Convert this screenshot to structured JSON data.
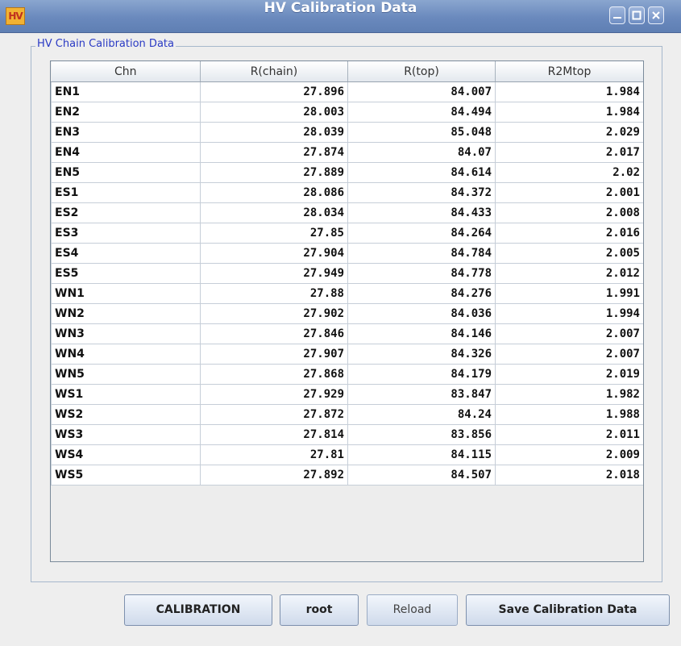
{
  "window": {
    "icon_text": "HV",
    "title": "HV Calibration Data"
  },
  "group": {
    "legend": "HV Chain Calibration Data"
  },
  "table": {
    "headers": [
      "Chn",
      "R(chain)",
      "R(top)",
      "R2Mtop"
    ],
    "rows": [
      [
        "EN1",
        "27.896",
        "84.007",
        "1.984"
      ],
      [
        "EN2",
        "28.003",
        "84.494",
        "1.984"
      ],
      [
        "EN3",
        "28.039",
        "85.048",
        "2.029"
      ],
      [
        "EN4",
        "27.874",
        "84.07",
        "2.017"
      ],
      [
        "EN5",
        "27.889",
        "84.614",
        "2.02"
      ],
      [
        "ES1",
        "28.086",
        "84.372",
        "2.001"
      ],
      [
        "ES2",
        "28.034",
        "84.433",
        "2.008"
      ],
      [
        "ES3",
        "27.85",
        "84.264",
        "2.016"
      ],
      [
        "ES4",
        "27.904",
        "84.784",
        "2.005"
      ],
      [
        "ES5",
        "27.949",
        "84.778",
        "2.012"
      ],
      [
        "WN1",
        "27.88",
        "84.276",
        "1.991"
      ],
      [
        "WN2",
        "27.902",
        "84.036",
        "1.994"
      ],
      [
        "WN3",
        "27.846",
        "84.146",
        "2.007"
      ],
      [
        "WN4",
        "27.907",
        "84.326",
        "2.007"
      ],
      [
        "WN5",
        "27.868",
        "84.179",
        "2.019"
      ],
      [
        "WS1",
        "27.929",
        "83.847",
        "1.982"
      ],
      [
        "WS2",
        "27.872",
        "84.24",
        "1.988"
      ],
      [
        "WS3",
        "27.814",
        "83.856",
        "2.011"
      ],
      [
        "WS4",
        "27.81",
        "84.115",
        "2.009"
      ],
      [
        "WS5",
        "27.892",
        "84.507",
        "2.018"
      ]
    ]
  },
  "buttons": {
    "calibration": "CALIBRATION",
    "root": "root",
    "reload": "Reload",
    "save": "Save Calibration Data"
  }
}
